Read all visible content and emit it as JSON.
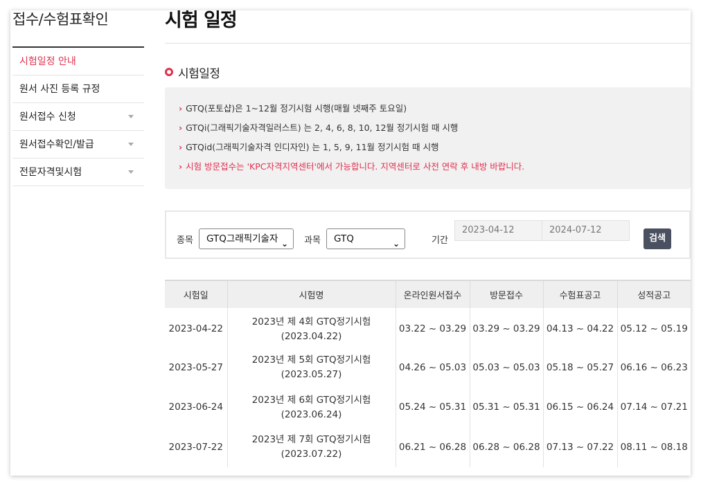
{
  "sidebar": {
    "title": "접수/수험표확인",
    "items": [
      {
        "label": "시험일정 안내"
      },
      {
        "label": "원서 사진 등록 규정"
      },
      {
        "label": "원서접수 신청"
      },
      {
        "label": "원서접수확인/발급"
      },
      {
        "label": "전문자격및시험"
      }
    ]
  },
  "main": {
    "title": "시험 일정",
    "section_title": "시험일정",
    "info": {
      "lines": [
        "GTQ(포토샵)은 1~12월 정기시험 시행(매월 넷째주 토요일)",
        "GTQi(그래픽기술자격일러스트) 는 2, 4, 6, 8, 10, 12월 정기시험 때 시행",
        "GTQid(그래픽기술자격 인디자인) 는 1, 5, 9, 11월 정기시험 때 시행",
        "시험 방문접수는 'KPC자격지역센터'에서 가능합니다. 지역센터로 사전 연락 후 내방 바랍니다."
      ],
      "arrow": "›"
    },
    "search": {
      "category_label": "종목",
      "category_value": "GTQ그래픽기술자",
      "subject_label": "과목",
      "subject_value": "GTQ",
      "period_label": "기간",
      "date_from": "2023-04-12",
      "date_to": "2024-07-12",
      "button_label": "검색",
      "chevron": "⌄"
    },
    "table": {
      "headers": [
        "시험일",
        "시험명",
        "온라인원서접수",
        "방문접수",
        "수험표공고",
        "성적공고"
      ],
      "rows": [
        {
          "date": "2023-04-22",
          "name1": "2023년 제 4회 GTQ정기시험",
          "name2": "(2023.04.22)",
          "online": "03.22 ~ 03.29",
          "visit": "03.29 ~ 03.29",
          "ticket": "04.13 ~ 04.22",
          "result": "05.12 ~ 05.19"
        },
        {
          "date": "2023-05-27",
          "name1": "2023년 제 5회 GTQ정기시험",
          "name2": "(2023.05.27)",
          "online": "04.26 ~ 05.03",
          "visit": "05.03 ~ 05.03",
          "ticket": "05.18 ~ 05.27",
          "result": "06.16 ~ 06.23"
        },
        {
          "date": "2023-06-24",
          "name1": "2023년 제 6회 GTQ정기시험",
          "name2": "(2023.06.24)",
          "online": "05.24 ~ 05.31",
          "visit": "05.31 ~ 05.31",
          "ticket": "06.15 ~ 06.24",
          "result": "07.14 ~ 07.21"
        },
        {
          "date": "2023-07-22",
          "name1": "2023년 제 7회 GTQ정기시험",
          "name2": "(2023.07.22)",
          "online": "06.21 ~ 06.28",
          "visit": "06.28 ~ 06.28",
          "ticket": "07.13 ~ 07.22",
          "result": "08.11 ~ 08.18"
        }
      ]
    },
    "colors": {
      "accent": "#e0314f",
      "button": "#4a5060"
    }
  }
}
